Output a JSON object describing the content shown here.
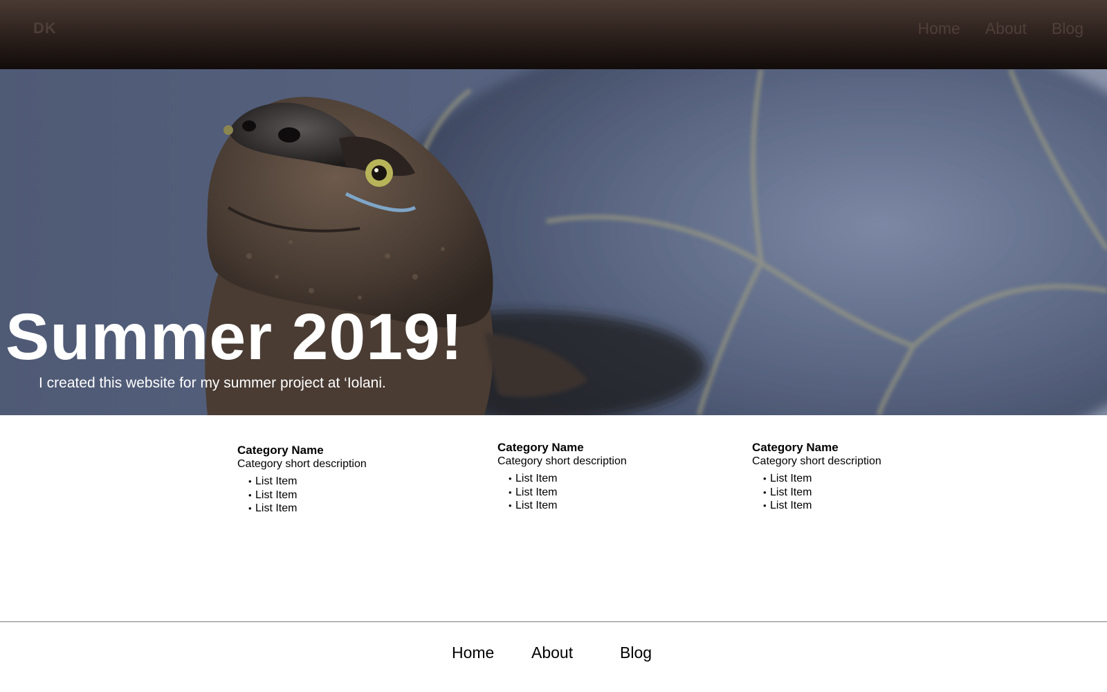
{
  "header": {
    "logo": "DK",
    "nav": [
      "Home",
      "About",
      "Blog"
    ]
  },
  "hero": {
    "title": "Summer 2019!",
    "subtitle": "I created this website for my summer project at ‘Iolani."
  },
  "categories": [
    {
      "name": "Category Name",
      "description": "Category short description",
      "items": [
        "List Item",
        "List Item",
        "List Item"
      ]
    },
    {
      "name": "Category Name",
      "description": "Category short description",
      "items": [
        "List Item",
        "List Item",
        "List Item"
      ]
    },
    {
      "name": "Category Name",
      "description": "Category short description",
      "items": [
        "List Item",
        "List Item",
        "List Item"
      ]
    }
  ],
  "footer": {
    "nav": [
      "Home",
      "About",
      "Blog"
    ]
  },
  "colors": {
    "header_top": "#4a3a33",
    "header_bottom": "#120c0a",
    "nav_text": "#4f3f38",
    "hero_text": "#ffffff",
    "body_text": "#000000"
  },
  "hero_image": "turtle-photo"
}
